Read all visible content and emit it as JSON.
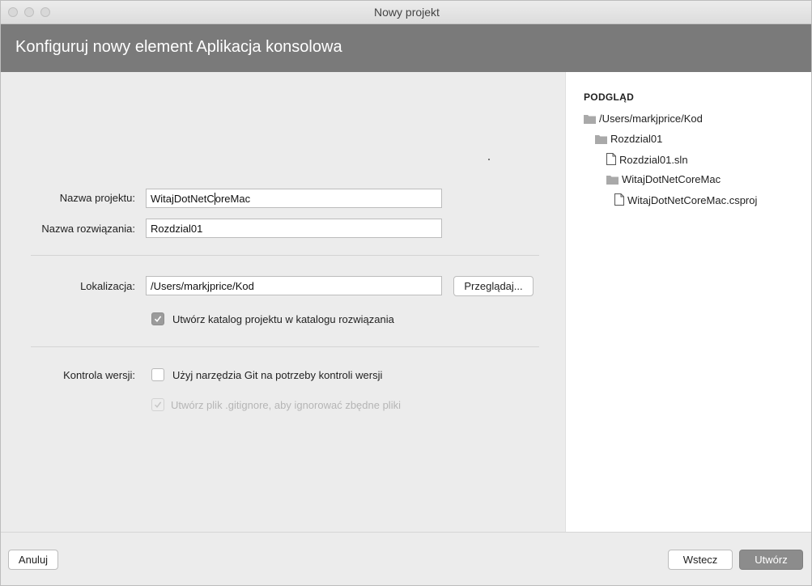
{
  "window": {
    "title": "Nowy projekt"
  },
  "header": {
    "title": "Konfiguruj nowy element Aplikacja konsolowa"
  },
  "form": {
    "project_name_label": "Nazwa projektu:",
    "project_name_value": "WitajDotNetCoreMac",
    "solution_name_label": "Nazwa rozwiązania:",
    "solution_name_value": "Rozdzial01",
    "location_label": "Lokalizacja:",
    "location_value": "/Users/markjprice/Kod",
    "browse_label": "Przeglądaj...",
    "create_dir_label": "Utwórz katalog projektu w katalogu rozwiązania",
    "create_dir_checked": true,
    "vcs_label": "Kontrola wersji:",
    "use_git_label": "Użyj narzędzia Git na potrzeby kontroli wersji",
    "use_git_checked": false,
    "gitignore_label": "Utwórz plik .gitignore, aby ignorować zbędne pliki",
    "gitignore_checked": true,
    "gitignore_enabled": false
  },
  "preview": {
    "title": "PODGLĄD",
    "tree": [
      {
        "label": "/Users/markjprice/Kod",
        "icon": "folder-icon",
        "depth": 0
      },
      {
        "label": "Rozdzial01",
        "icon": "folder-icon",
        "depth": 1
      },
      {
        "label": "Rozdzial01.sln",
        "icon": "file-icon",
        "depth": 2
      },
      {
        "label": "WitajDotNetCoreMac",
        "icon": "folder-icon",
        "depth": 2
      },
      {
        "label": "WitajDotNetCoreMac.csproj",
        "icon": "file-icon",
        "depth": 3
      }
    ]
  },
  "footer": {
    "cancel_label": "Anuluj",
    "back_label": "Wstecz",
    "create_label": "Utwórz"
  },
  "colors": {
    "banner": "#7a7a7a",
    "primary_button": "#8c8c8c",
    "folder_icon": "#a9a9a9"
  }
}
